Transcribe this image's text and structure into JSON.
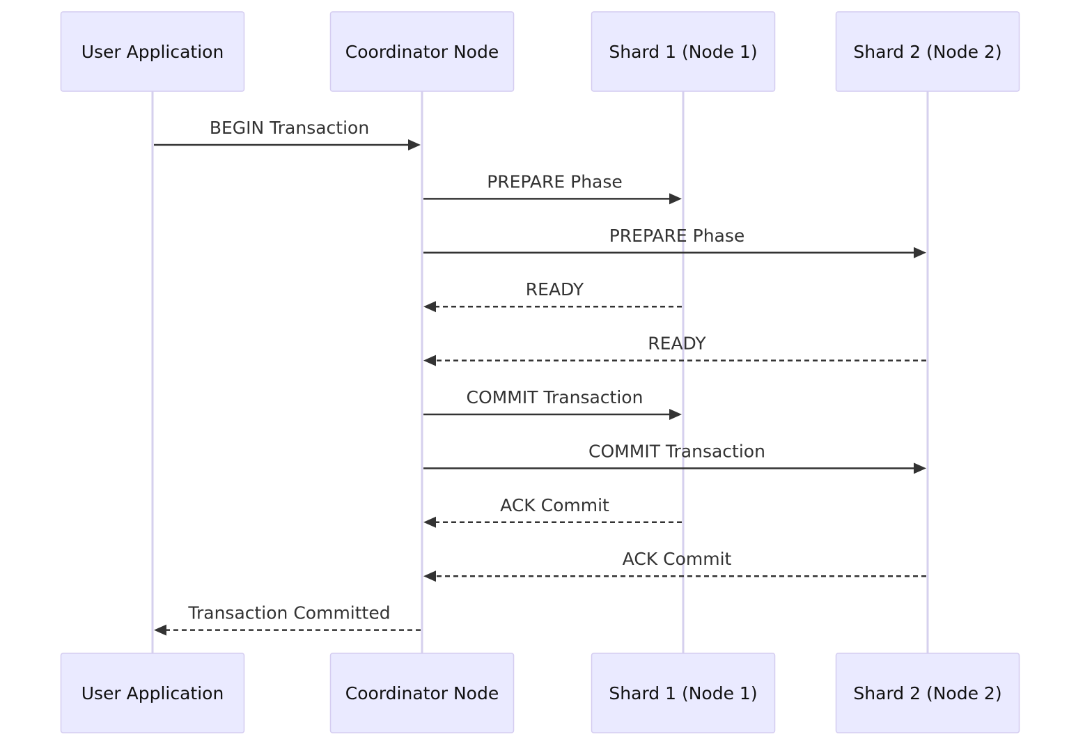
{
  "diagram": {
    "type": "sequence",
    "actors": [
      {
        "id": "user",
        "label": "User Application"
      },
      {
        "id": "coord",
        "label": "Coordinator Node"
      },
      {
        "id": "shard1",
        "label": "Shard 1 (Node 1)"
      },
      {
        "id": "shard2",
        "label": "Shard 2 (Node 2)"
      }
    ],
    "messages": [
      {
        "from": "user",
        "to": "coord",
        "label": "BEGIN Transaction",
        "style": "solid"
      },
      {
        "from": "coord",
        "to": "shard1",
        "label": "PREPARE Phase",
        "style": "solid"
      },
      {
        "from": "coord",
        "to": "shard2",
        "label": "PREPARE Phase",
        "style": "solid"
      },
      {
        "from": "shard1",
        "to": "coord",
        "label": "READY",
        "style": "dashed"
      },
      {
        "from": "shard2",
        "to": "coord",
        "label": "READY",
        "style": "dashed"
      },
      {
        "from": "coord",
        "to": "shard1",
        "label": "COMMIT Transaction",
        "style": "solid"
      },
      {
        "from": "coord",
        "to": "shard2",
        "label": "COMMIT Transaction",
        "style": "solid"
      },
      {
        "from": "shard1",
        "to": "coord",
        "label": "ACK Commit",
        "style": "dashed"
      },
      {
        "from": "shard2",
        "to": "coord",
        "label": "ACK Commit",
        "style": "dashed"
      },
      {
        "from": "coord",
        "to": "user",
        "label": "Transaction Committed",
        "style": "dashed"
      }
    ],
    "colors": {
      "actor_fill": "#eaeaff",
      "actor_border": "#d4ccf0",
      "lifeline": "#d6d0ee",
      "message": "#333333"
    }
  }
}
